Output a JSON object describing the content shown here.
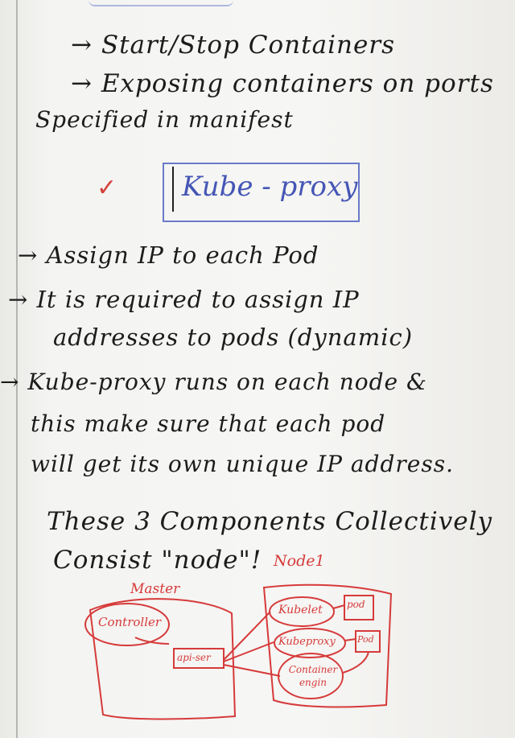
{
  "notes": {
    "line1": "→ Start/Stop Containers",
    "line2": "→ Exposing containers on ports",
    "line3": "Specified in manifest",
    "line4": "→ Assign IP to each Pod",
    "line5": "→ It is required to assign IP",
    "line6": "addresses to pods (dynamic)",
    "line7": "→ Kube-proxy runs on each node &",
    "line8": "this make sure that each pod",
    "line9": "will get its own unique IP address.",
    "line10": "These 3 Components Collectively",
    "line11": "Consist \"node\"!"
  },
  "heading": {
    "title": "Kube - proxy",
    "check_mark": "✓"
  },
  "diagram": {
    "master_label": "Master",
    "node_label": "Node1",
    "controller": "Controller",
    "api_server": "api-ser",
    "kubelet": "Kubelet",
    "kube_proxy": "Kubeproxy",
    "container_engine": "Container engin",
    "pod1": "pod",
    "pod2": "Pod",
    "ink_color": "#d63a3a"
  },
  "colors": {
    "highlight_blue": "#4556b5",
    "check_red": "#d4413c"
  }
}
